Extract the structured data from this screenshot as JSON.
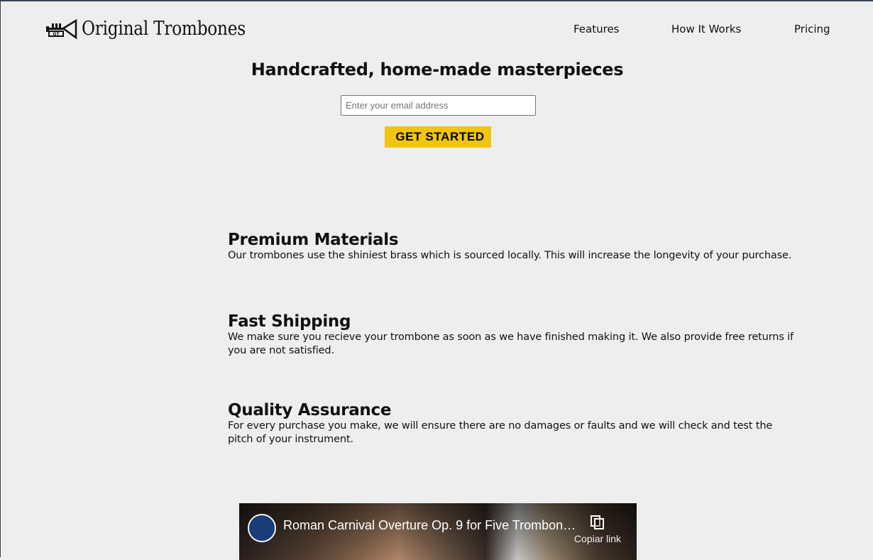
{
  "brand": {
    "name": "Original Trombones",
    "logo_icon": "trumpet-logo-icon",
    "logo_monogram": "OT"
  },
  "nav": {
    "items": [
      "Features",
      "How It Works",
      "Pricing"
    ]
  },
  "hero": {
    "title": "Handcrafted, home-made masterpieces",
    "email_placeholder": "Enter your email address",
    "email_value": "",
    "cta_label": "GET STARTED"
  },
  "features": [
    {
      "title": "Premium Materials",
      "text": "Our trombones use the shiniest brass which is sourced locally. This will increase the longevity of your purchase."
    },
    {
      "title": "Fast Shipping",
      "text": "We make sure you recieve your trombone as soon as we have finished making it. We also provide free returns if you are not satisfied."
    },
    {
      "title": "Quality Assurance",
      "text": "For every purchase you make, we will ensure there are no damages or faults and we will check and test the pitch of your instrument."
    }
  ],
  "video": {
    "title": "Roman Carnival Overture Op. 9 for Five Trombon…",
    "copy_label": "Copiar link",
    "copy_icon": "copy-icon",
    "channel_icon": "channel-avatar-icon"
  },
  "colors": {
    "background": "#eeeeee",
    "cta": "#f1c40f",
    "text": "#111111"
  }
}
